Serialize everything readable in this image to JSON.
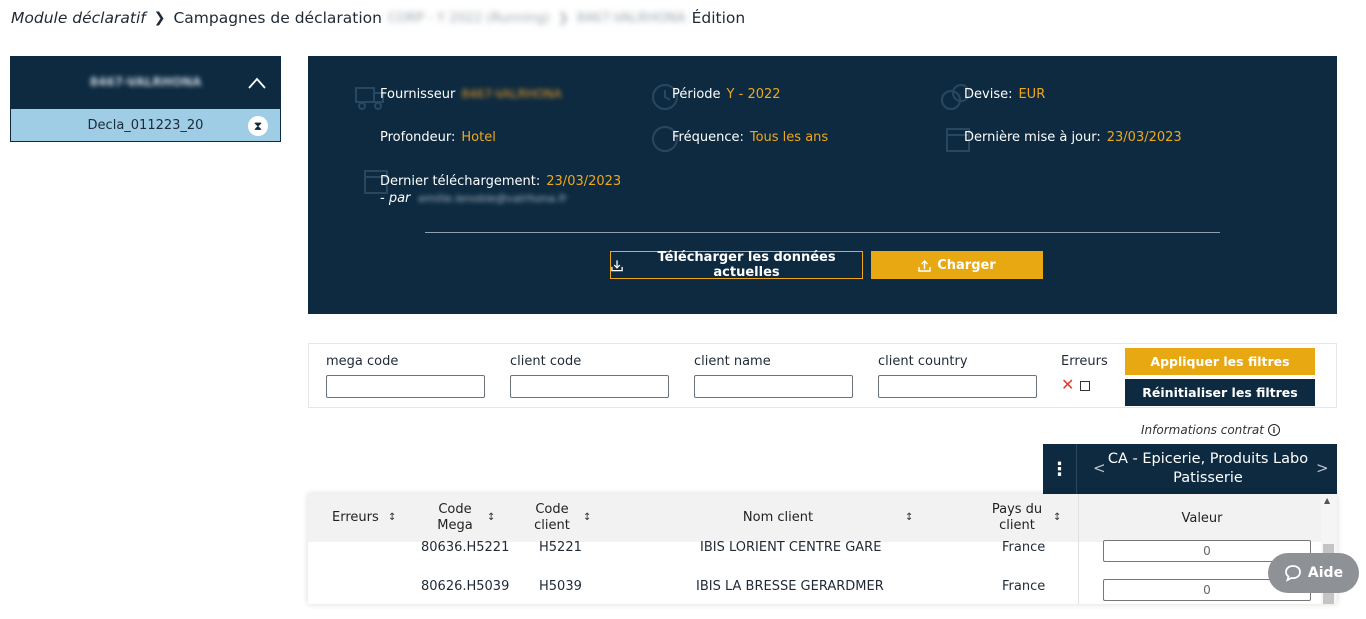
{
  "breadcrumb": {
    "module": "Module déclaratif",
    "campaigns": "Campagnes de déclaration",
    "campaign": "CORP - Y 2022 (Running)",
    "supplier": "8467-VALRHONA",
    "mode": "Édition"
  },
  "sidebar": {
    "header": "8467-VALRHONA",
    "item": "Decla_011223_20"
  },
  "info": {
    "fournisseur_label": "Fournisseur",
    "fournisseur_value": "8467-VALRHONA",
    "periode_label": "Période",
    "periode_value": "Y - 2022",
    "devise_label": "Devise:",
    "devise_value": "EUR",
    "profondeur_label": "Profondeur:",
    "profondeur_value": "Hotel",
    "frequence_label": "Fréquence:",
    "frequence_value": "Tous les ans",
    "maj_label": "Dernière mise à jour:",
    "maj_value": "23/03/2023",
    "dl_label": "Dernier téléchargement:",
    "dl_value": "23/03/2023",
    "par_label": "- par",
    "par_value": "emilie.lenoble@valrhona.fr",
    "download_button": "Télécharger les données actuelles",
    "upload_button": "Charger"
  },
  "filters": {
    "mega_code": "mega code",
    "client_code": "client code",
    "client_name": "client name",
    "client_country": "client country",
    "erreurs": "Erreurs",
    "apply": "Appliquer les filtres",
    "reset": "Réinitialiser les filtres"
  },
  "contract_info": "Informations contrat",
  "column_header": {
    "title": "CA - Epicerie, Produits Labo Patisserie"
  },
  "table": {
    "headers": {
      "erreurs": "Erreurs",
      "code_mega": "Code Mega",
      "code_client": "Code client",
      "nom_client": "Nom client",
      "pays_client": "Pays du client",
      "valeur": "Valeur"
    },
    "rows": [
      {
        "code_mega": "80636.H5221",
        "code_client": "H5221",
        "nom_client": "IBIS LORIENT CENTRE GARE",
        "pays": "France",
        "valeur": "0"
      },
      {
        "code_mega": "80626.H5039",
        "code_client": "H5039",
        "nom_client": "IBIS LA BRESSE GERARDMER",
        "pays": "France",
        "valeur": "0"
      }
    ]
  },
  "help_button": "Aide"
}
